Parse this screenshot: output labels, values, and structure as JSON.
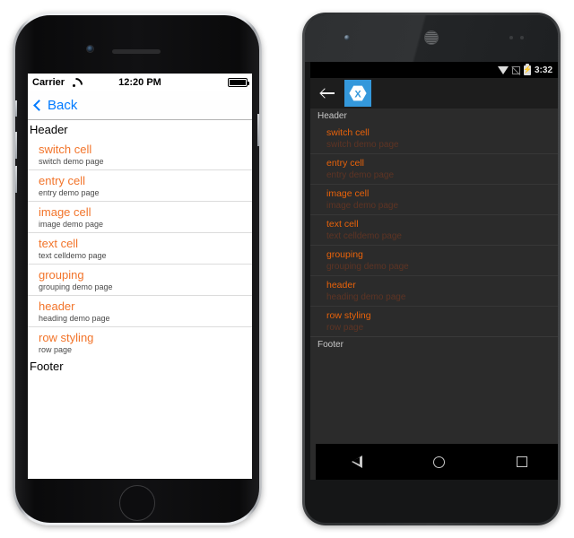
{
  "ios": {
    "status": {
      "carrier": "Carrier",
      "wifi_icon": "wifi-icon",
      "time": "12:20 PM",
      "battery_icon": "battery-full-icon"
    },
    "nav": {
      "back_label": "Back",
      "back_chevron_icon": "chevron-left-icon",
      "accent_color": "#007aff"
    },
    "list": {
      "header": "Header",
      "footer": "Footer",
      "title_color": "#f2742a",
      "detail_color": "#4a4a4a",
      "rows": [
        {
          "title": "switch cell",
          "detail": "switch demo page"
        },
        {
          "title": "entry cell",
          "detail": "entry demo page"
        },
        {
          "title": "image cell",
          "detail": "image demo page"
        },
        {
          "title": "text cell",
          "detail": "text celldemo page"
        },
        {
          "title": "grouping",
          "detail": "grouping demo page"
        },
        {
          "title": "header",
          "detail": "heading demo page"
        },
        {
          "title": "row styling",
          "detail": "row page"
        }
      ]
    },
    "hardware": {
      "camera_icon": "front-camera-icon",
      "speaker_icon": "earpiece-speaker-icon",
      "home_button_icon": "home-button-icon"
    }
  },
  "android": {
    "status": {
      "wifi_icon": "wifi-icon",
      "signal_icon": "no-signal-icon",
      "battery_icon": "battery-charging-icon",
      "battery_glyph": "⚡",
      "time": "3:32"
    },
    "action_bar": {
      "back_icon": "arrow-left-icon",
      "app_icon": "xamarin-logo-icon",
      "app_icon_color": "#3498db"
    },
    "list": {
      "header": "Header",
      "footer": "Footer",
      "title_color": "#e8620a",
      "detail_color": "#5e3424",
      "rows": [
        {
          "title": "switch cell",
          "detail": "switch demo page"
        },
        {
          "title": "entry cell",
          "detail": "entry demo page"
        },
        {
          "title": "image cell",
          "detail": "image demo page"
        },
        {
          "title": "text cell",
          "detail": "text celldemo page"
        },
        {
          "title": "grouping",
          "detail": "grouping demo page"
        },
        {
          "title": "header",
          "detail": "heading demo page"
        },
        {
          "title": "row styling",
          "detail": "row page"
        }
      ]
    },
    "navbar": {
      "back_icon": "nav-back-icon",
      "home_icon": "nav-home-icon",
      "recents_icon": "nav-recents-icon"
    },
    "hardware": {
      "camera_icon": "front-camera-icon",
      "speaker_icon": "earpiece-speaker-icon",
      "sensor_icon": "proximity-sensor-icon"
    }
  }
}
